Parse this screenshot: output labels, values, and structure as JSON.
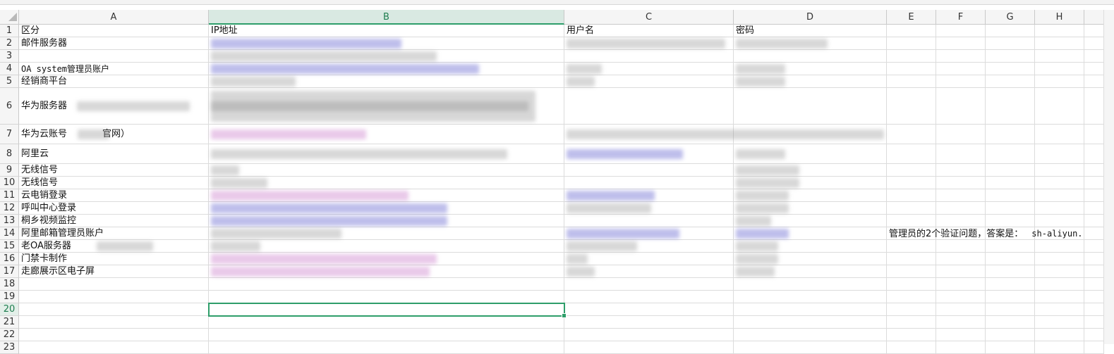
{
  "columns": [
    "A",
    "B",
    "C",
    "D",
    "E",
    "F",
    "G",
    "H"
  ],
  "selected_column": "B",
  "rows": [
    "1",
    "2",
    "3",
    "4",
    "5",
    "6",
    "7",
    "8",
    "9",
    "10",
    "11",
    "12",
    "13",
    "14",
    "15",
    "16",
    "17",
    "18",
    "19",
    "20",
    "21",
    "22",
    "23"
  ],
  "selected_row": "20",
  "cells": {
    "A1": "区分",
    "B1": "IP地址",
    "C1": "用户名",
    "D1": "密码",
    "A2": "邮件服务器",
    "A4": "OA system管理员账户",
    "A5": "经销商平台",
    "A6": "华为服务器",
    "A7a": "华为云账号",
    "A7b": "官网）",
    "A8": "阿里云",
    "A9": "无线信号",
    "A10": "无线信号",
    "A11": "云电销登录",
    "A12": "呼叫中心登录",
    "A13": "桐乡视频监控",
    "A14": "阿里邮箱管理员账户",
    "A15": "老OA服务器",
    "A16": "门禁卡制作",
    "A17": "走廊展示区电子屏",
    "E14": "管理员的2个验证问题，答案是：",
    "E14b": "sh-aliyun."
  }
}
